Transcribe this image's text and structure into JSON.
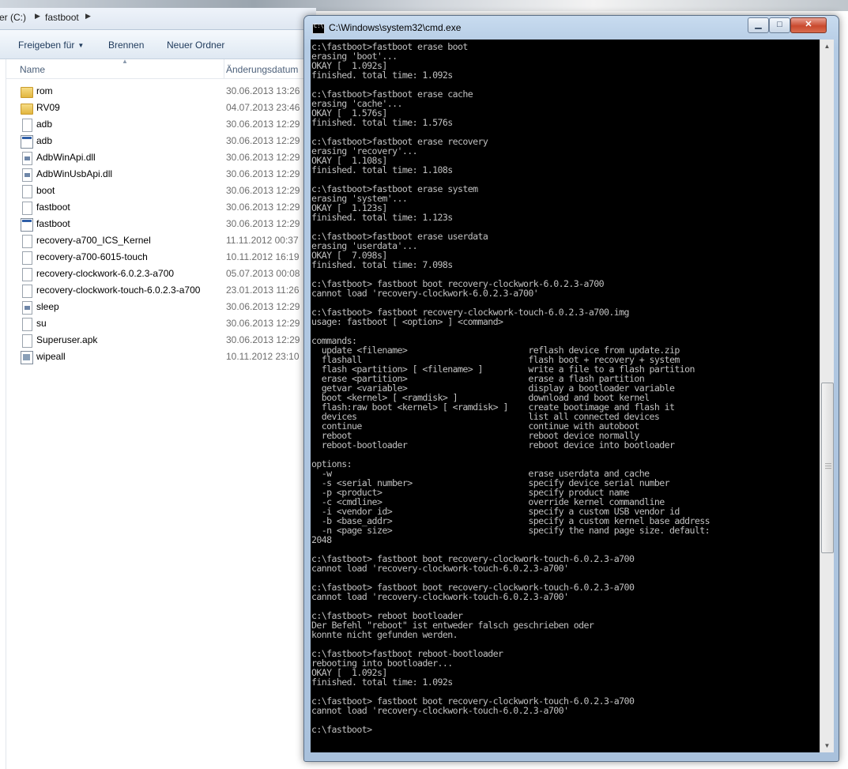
{
  "explorer": {
    "breadcrumb": [
      "er (C:)",
      "fastboot"
    ],
    "toolbar": [
      "Freigeben für",
      "Brennen",
      "Neuer Ordner"
    ],
    "columns": {
      "name": "Name",
      "date": "Änderungsdatum"
    },
    "files": [
      {
        "name": "rom",
        "date": "30.06.2013 13:26",
        "icon": "folder-icon"
      },
      {
        "name": "RV09",
        "date": "04.07.2013 23:46",
        "icon": "folder-icon"
      },
      {
        "name": "adb",
        "date": "30.06.2013 12:29",
        "icon": "file-icon"
      },
      {
        "name": "adb",
        "date": "30.06.2013 12:29",
        "icon": "exe-icon"
      },
      {
        "name": "AdbWinApi.dll",
        "date": "30.06.2013 12:29",
        "icon": "dll-icon"
      },
      {
        "name": "AdbWinUsbApi.dll",
        "date": "30.06.2013 12:29",
        "icon": "dll-icon"
      },
      {
        "name": "boot",
        "date": "30.06.2013 12:29",
        "icon": "file-icon"
      },
      {
        "name": "fastboot",
        "date": "30.06.2013 12:29",
        "icon": "file-icon"
      },
      {
        "name": "fastboot",
        "date": "30.06.2013 12:29",
        "icon": "exe-icon"
      },
      {
        "name": "recovery-a700_ICS_Kernel",
        "date": "11.11.2012 00:37",
        "icon": "file-icon"
      },
      {
        "name": "recovery-a700-6015-touch",
        "date": "10.11.2012 16:19",
        "icon": "file-icon"
      },
      {
        "name": "recovery-clockwork-6.0.2.3-a700",
        "date": "05.07.2013 00:08",
        "icon": "file-icon"
      },
      {
        "name": "recovery-clockwork-touch-6.0.2.3-a700",
        "date": "23.01.2013 11:26",
        "icon": "file-icon"
      },
      {
        "name": "sleep",
        "date": "30.06.2013 12:29",
        "icon": "dll-icon"
      },
      {
        "name": "su",
        "date": "30.06.2013 12:29",
        "icon": "file-icon"
      },
      {
        "name": "Superuser.apk",
        "date": "30.06.2013 12:29",
        "icon": "file-icon"
      },
      {
        "name": "wipeall",
        "date": "10.11.2012 23:10",
        "icon": "batch-icon"
      }
    ]
  },
  "cmd": {
    "title": "C:\\Windows\\system32\\cmd.exe",
    "icon_label": "C:\\",
    "buttons": {
      "minimize": "▁",
      "maximize": "□",
      "close": "✕"
    },
    "lines": [
      "c:\\fastboot>fastboot erase boot",
      "erasing 'boot'...",
      "OKAY [  1.092s]",
      "finished. total time: 1.092s",
      "",
      "c:\\fastboot>fastboot erase cache",
      "erasing 'cache'...",
      "OKAY [  1.576s]",
      "finished. total time: 1.576s",
      "",
      "c:\\fastboot>fastboot erase recovery",
      "erasing 'recovery'...",
      "OKAY [  1.108s]",
      "finished. total time: 1.108s",
      "",
      "c:\\fastboot>fastboot erase system",
      "erasing 'system'...",
      "OKAY [  1.123s]",
      "finished. total time: 1.123s",
      "",
      "c:\\fastboot>fastboot erase userdata",
      "erasing 'userdata'...",
      "OKAY [  7.098s]",
      "finished. total time: 7.098s",
      "",
      "c:\\fastboot> fastboot boot recovery-clockwork-6.0.2.3-a700",
      "cannot load 'recovery-clockwork-6.0.2.3-a700'",
      "",
      "c:\\fastboot> fastboot recovery-clockwork-touch-6.0.2.3-a700.img",
      "usage: fastboot [ <option> ] <command>",
      "",
      "commands:",
      "  update <filename>                        reflash device from update.zip",
      "  flashall                                 flash boot + recovery + system",
      "  flash <partition> [ <filename> ]         write a file to a flash partition",
      "  erase <partition>                        erase a flash partition",
      "  getvar <variable>                        display a bootloader variable",
      "  boot <kernel> [ <ramdisk> ]              download and boot kernel",
      "  flash:raw boot <kernel> [ <ramdisk> ]    create bootimage and flash it",
      "  devices                                  list all connected devices",
      "  continue                                 continue with autoboot",
      "  reboot                                   reboot device normally",
      "  reboot-bootloader                        reboot device into bootloader",
      "",
      "options:",
      "  -w                                       erase userdata and cache",
      "  -s <serial number>                       specify device serial number",
      "  -p <product>                             specify product name",
      "  -c <cmdline>                             override kernel commandline",
      "  -i <vendor id>                           specify a custom USB vendor id",
      "  -b <base_addr>                           specify a custom kernel base address",
      "  -n <page size>                           specify the nand page size. default:",
      "2048",
      "",
      "c:\\fastboot> fastboot boot recovery-clockwork-touch-6.0.2.3-a700",
      "cannot load 'recovery-clockwork-touch-6.0.2.3-a700'",
      "",
      "c:\\fastboot> fastboot boot recovery-clockwork-touch-6.0.2.3-a700",
      "cannot load 'recovery-clockwork-touch-6.0.2.3-a700'",
      "",
      "c:\\fastboot> reboot bootloader",
      "Der Befehl \"reboot\" ist entweder falsch geschrieben oder",
      "konnte nicht gefunden werden.",
      "",
      "c:\\fastboot>fastboot reboot-bootloader",
      "rebooting into bootloader...",
      "OKAY [  1.092s]",
      "finished. total time: 1.092s",
      "",
      "c:\\fastboot> fastboot boot recovery-clockwork-touch-6.0.2.3-a700",
      "cannot load 'recovery-clockwork-touch-6.0.2.3-a700'",
      "",
      "c:\\fastboot>"
    ]
  }
}
